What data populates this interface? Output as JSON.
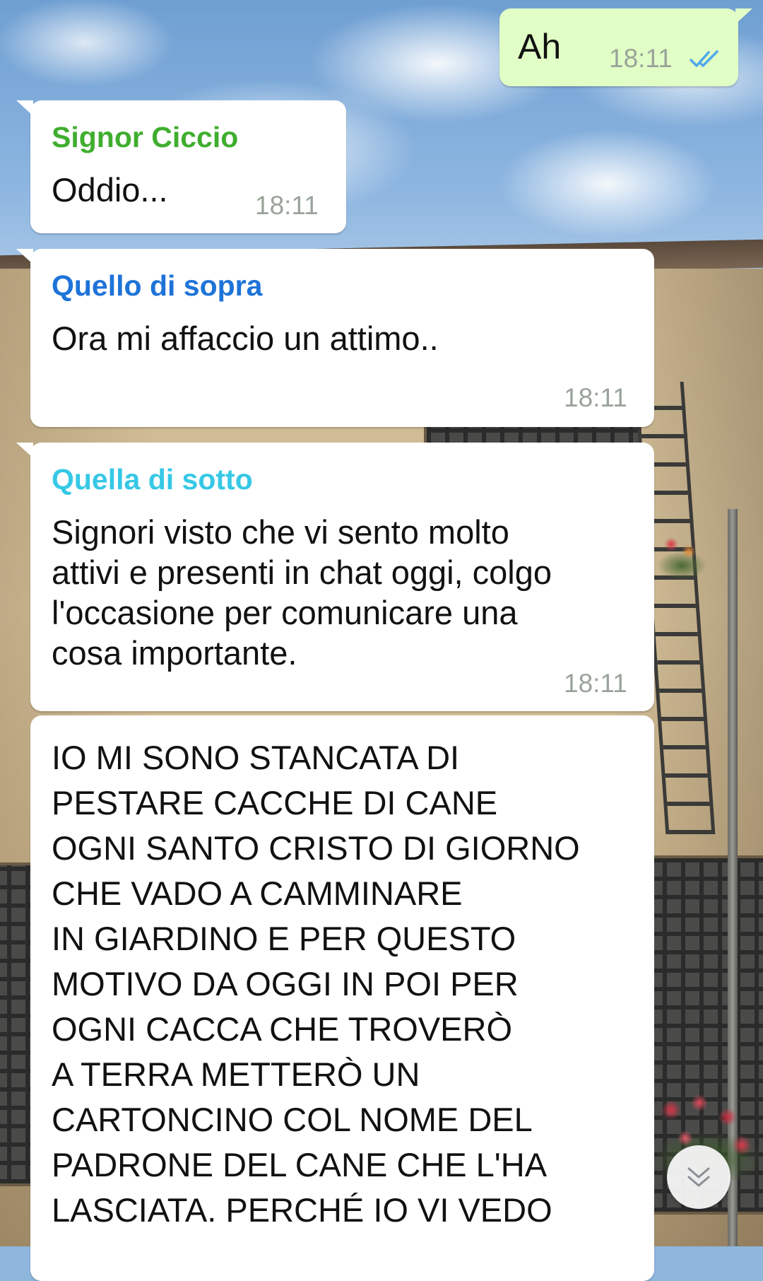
{
  "colors": {
    "incoming_bubble": "#ffffff",
    "outgoing_bubble": "#e1fec6",
    "read_ticks": "#4fa8e8",
    "timestamp": "#9aa39a"
  },
  "messages": [
    {
      "direction": "outgoing",
      "text": "Ah",
      "time": "18:11",
      "status_icon": "double-check-read-icon"
    },
    {
      "direction": "incoming",
      "sender": "Signor Ciccio",
      "sender_color": "#3fae2e",
      "text": "Oddio...",
      "time": "18:11"
    },
    {
      "direction": "incoming",
      "sender": "Quello di sopra",
      "sender_color": "#1e73d8",
      "text": "Ora mi affaccio un attimo..",
      "time": "18:11"
    },
    {
      "direction": "incoming",
      "sender": "Quella di sotto",
      "sender_color": "#36c8e6",
      "text": "Signori visto che vi sento molto\nattivi e presenti in chat oggi, colgo\nl'occasione per comunicare una\ncosa importante.",
      "time": "18:11"
    },
    {
      "direction": "incoming",
      "text": "IO MI SONO STANCATA DI\nPESTARE CACCHE DI CANE\nOGNI SANTO CRISTO DI GIORNO\nCHE VADO A CAMMINARE\nIN GIARDINO E PER QUESTO\nMOTIVO DA OGGI IN POI PER\nOGNI CACCA CHE TROVERÒ\nA TERRA METTERÒ UN\nCARTONCINO COL NOME DEL\nPADRONE DEL CANE CHE L'HA\nLASCIATA. PERCHÉ IO VI VEDO"
    }
  ],
  "scroll_button": {
    "icon": "double-chevron-down-icon"
  }
}
